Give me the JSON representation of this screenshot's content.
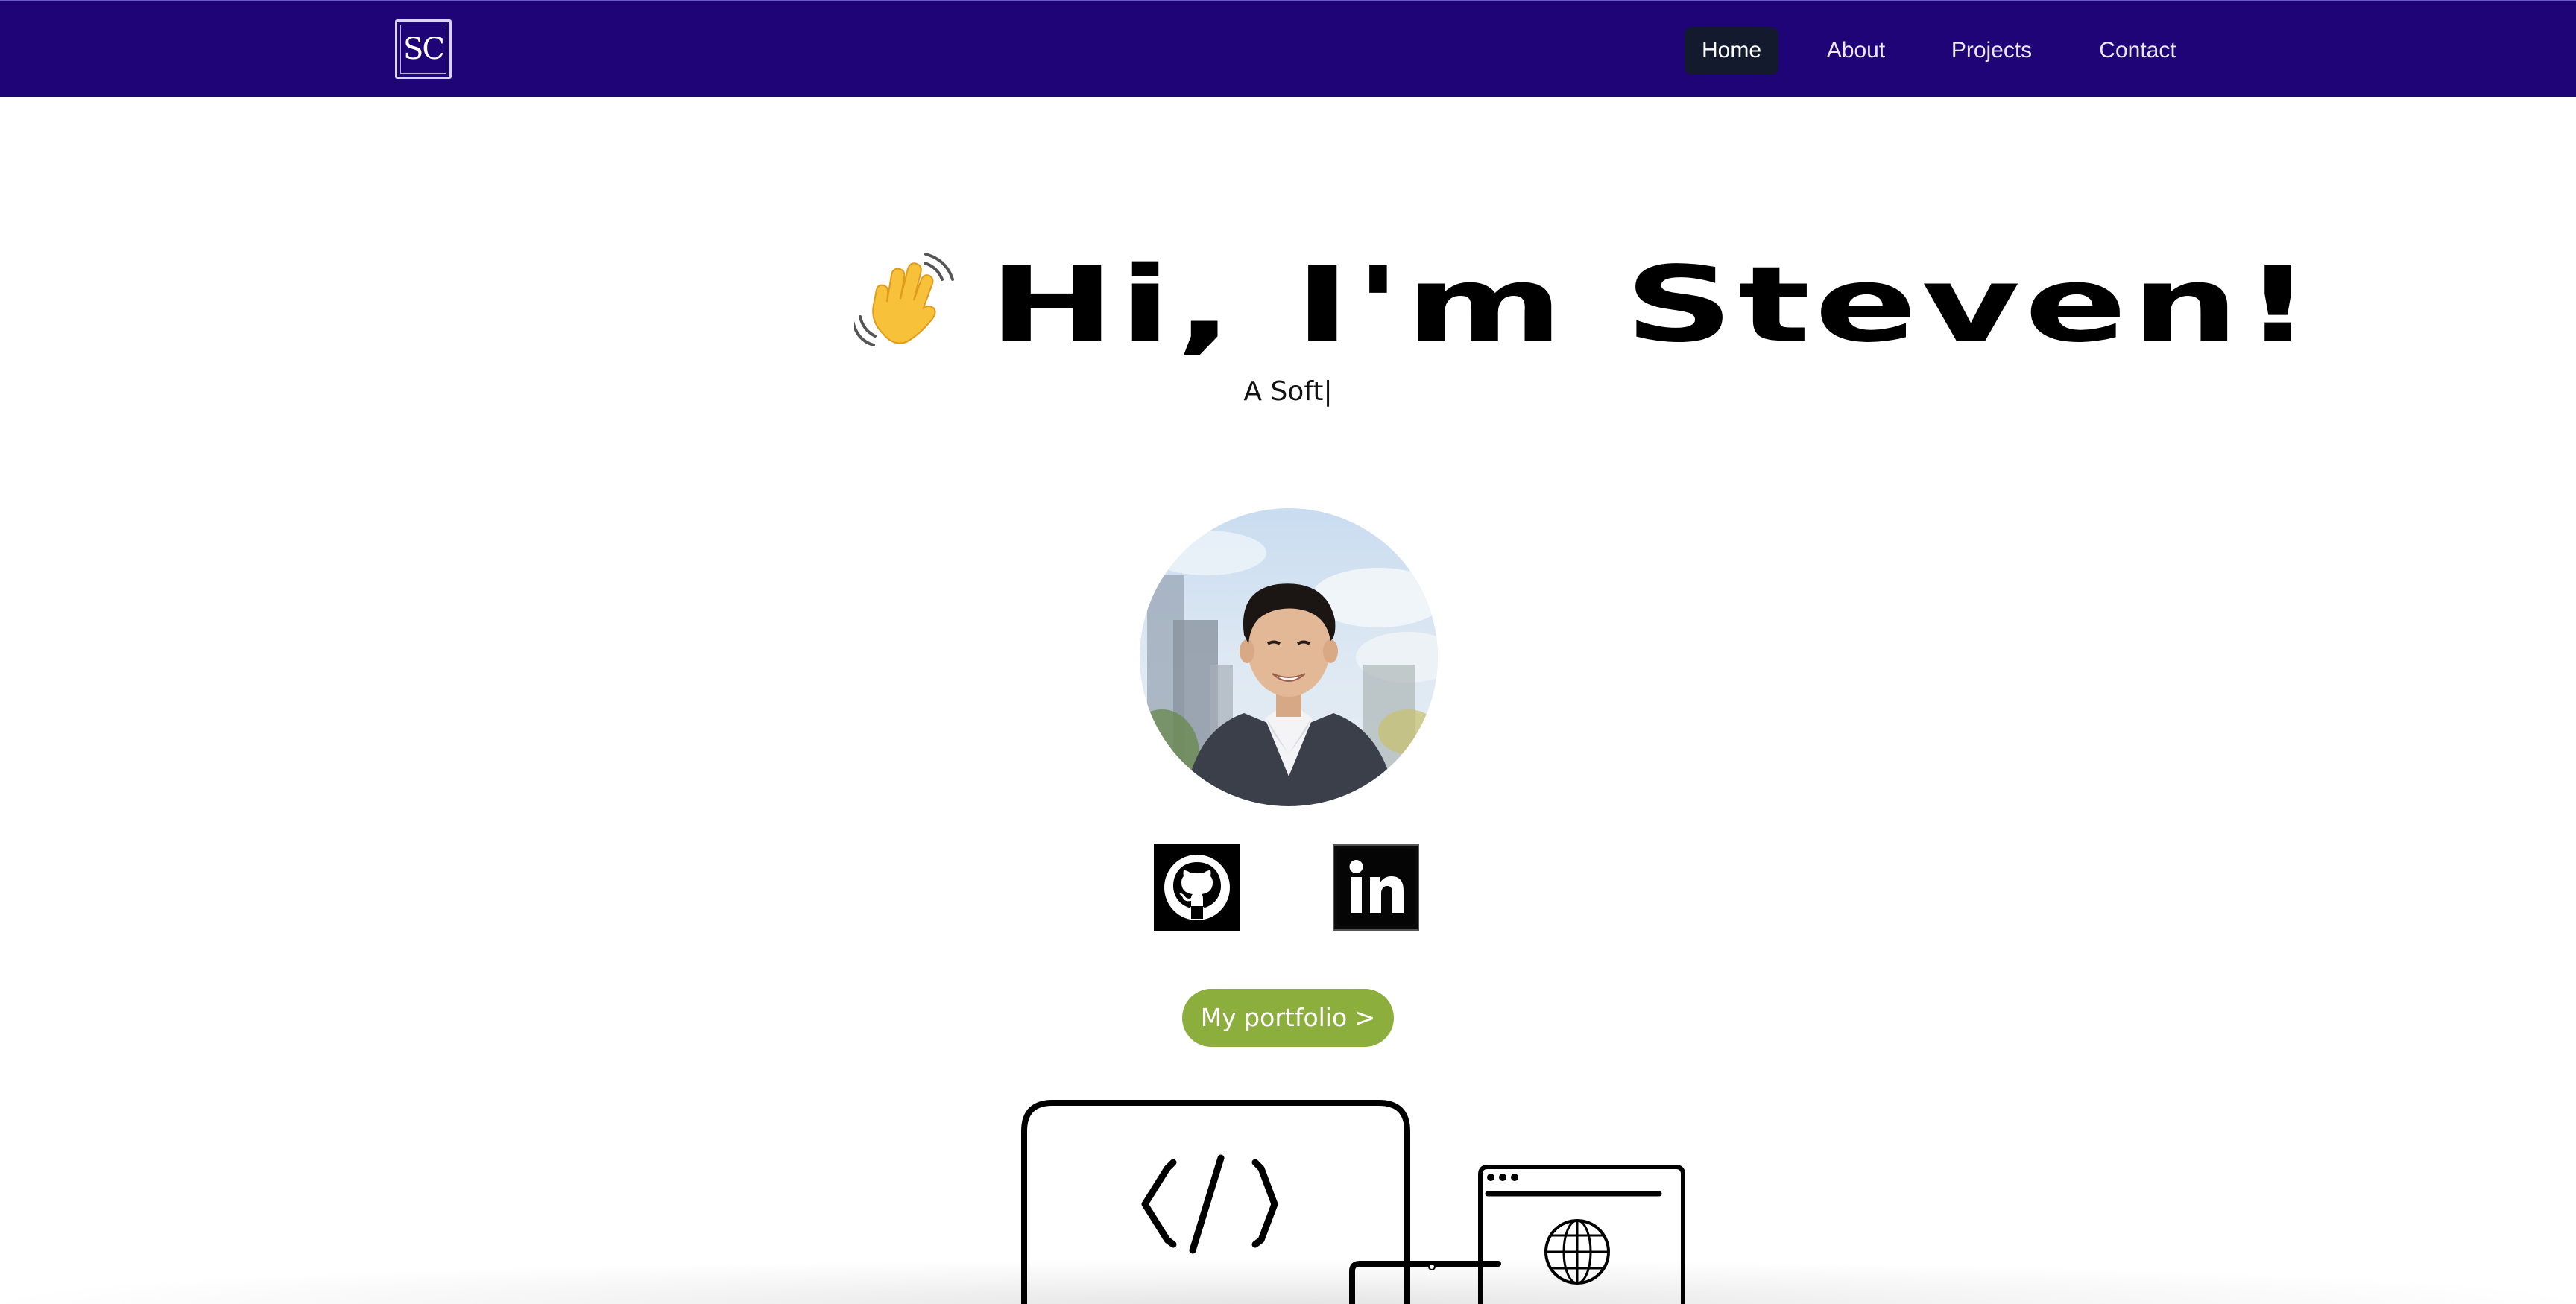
{
  "logo": {
    "text": "SC"
  },
  "nav": {
    "items": [
      {
        "label": "Home",
        "active": true
      },
      {
        "label": "About",
        "active": false
      },
      {
        "label": "Projects",
        "active": false
      },
      {
        "label": "Contact",
        "active": false
      }
    ]
  },
  "hero": {
    "title": "Hi, I'm Steven!",
    "subtitle": "A Soft|"
  },
  "social": {
    "github_icon": "github-icon",
    "linkedin_icon": "linkedin-icon"
  },
  "cta": {
    "label": "My portfolio >"
  },
  "colors": {
    "navbar": "#1f0477",
    "active_tab": "#141a2e",
    "cta": "#8cae3d"
  }
}
